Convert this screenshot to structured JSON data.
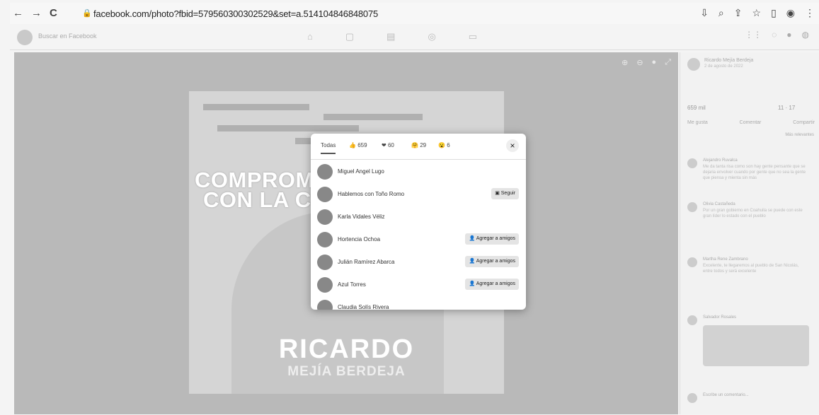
{
  "browser": {
    "url": "facebook.com/photo?fbid=579560300302529&set=a.514104846848075",
    "back_glyph": "←",
    "forward_glyph": "→",
    "reload_glyph": "C"
  },
  "fb": {
    "search_placeholder": "Buscar en Facebook"
  },
  "poster": {
    "headline_line1": "COMPROM",
    "headline_line2": "CON LA C",
    "name_line1": "RICARDO",
    "name_line2": "MEJÍA BERDEJA"
  },
  "modal": {
    "tabs": [
      {
        "label": "Todas",
        "active": true
      },
      {
        "label": "659",
        "icon": "like-reaction-icon"
      },
      {
        "label": "60",
        "icon": "love-reaction-icon"
      },
      {
        "label": "29",
        "icon": "care-reaction-icon"
      },
      {
        "label": "6",
        "icon": "wow-reaction-icon"
      }
    ],
    "close_glyph": "×",
    "people": [
      {
        "name": "Miguel Angel Lugo",
        "action": ""
      },
      {
        "name": "Hablemos con Toño Romo",
        "action": "Seguir"
      },
      {
        "name": "Karla Vidales Véliz",
        "action": ""
      },
      {
        "name": "Hortencia Ochoa",
        "action": "Agregar a amigos"
      },
      {
        "name": "Julián Ramírez Abarca",
        "action": "Agregar a amigos"
      },
      {
        "name": "Azul Torres",
        "action": "Agregar a amigos"
      },
      {
        "name": "Claudia Solís Rivera",
        "action": ""
      }
    ]
  },
  "panel": {
    "author": "Ricardo Mejía Berdeja",
    "date": "2 de agosto de 2022",
    "reaction_count": "659 mil",
    "comments_count": "11",
    "shares_count": "17",
    "actions": [
      "Me gusta",
      "Comentar",
      "Compartir"
    ],
    "more_comments": "Más relevantes",
    "comments": [
      {
        "name": "Alejandro Ruvalca",
        "text": "Me da tanta risa como son hay gente pensante que se dejaria envolver cuando por gente que no sea la gente que piensa y mienta sin más"
      },
      {
        "name": "Olivia Castañeda",
        "text": "Por un gran gobierno en Coahuila se puede con este gran líder lo estado con el pueblo"
      },
      {
        "name": "Martha Rene Zambrano",
        "text": "Excelente, te llegaremos al pueblo de San Nicolás, entre todos y será excelente"
      },
      {
        "name": "Salvador Rosales",
        "text": "",
        "has_image": true
      },
      {
        "name": "Escribe un comentario...",
        "text": ""
      }
    ]
  }
}
